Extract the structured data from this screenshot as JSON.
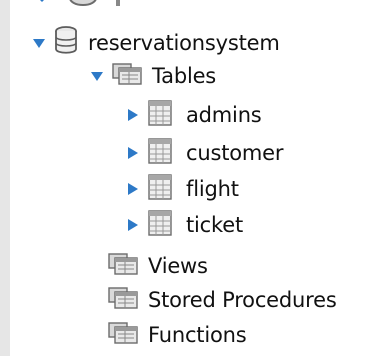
{
  "tree": {
    "database": {
      "label": "reservationsystem",
      "expanded": true,
      "icon": "database-icon"
    },
    "tables": {
      "label": "Tables",
      "expanded": true,
      "icon": "folder-icon",
      "items": [
        {
          "label": "admins",
          "icon": "table-icon"
        },
        {
          "label": "customer",
          "icon": "table-icon"
        },
        {
          "label": "flight",
          "icon": "table-icon"
        },
        {
          "label": "ticket",
          "icon": "table-icon"
        }
      ]
    },
    "views": {
      "label": "Views",
      "icon": "folder-icon"
    },
    "stored_procedures": {
      "label": "Stored Procedures",
      "icon": "folder-icon"
    },
    "functions": {
      "label": "Functions",
      "icon": "folder-icon"
    }
  },
  "colors": {
    "arrow": "#2d79c7",
    "text": "#111111",
    "rail": "#e6e6e6"
  }
}
